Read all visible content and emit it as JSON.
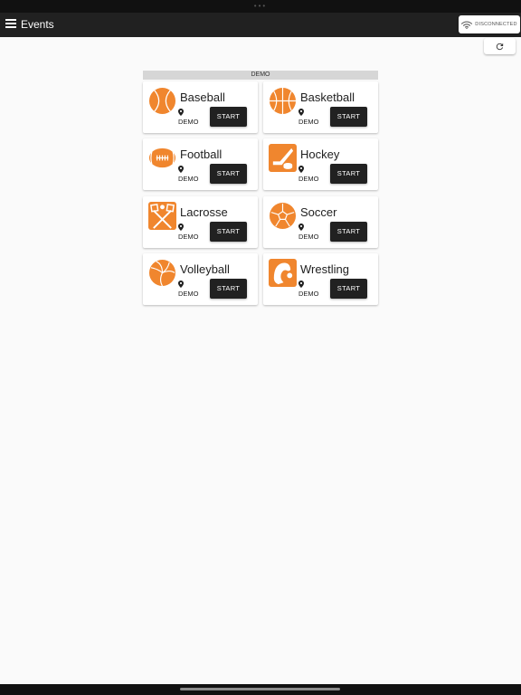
{
  "app": {
    "title": "Events"
  },
  "connection": {
    "status": "DISCONNECTED"
  },
  "group": {
    "label": "DEMO"
  },
  "accent_color": "#f0862e",
  "events": [
    {
      "name": "Baseball",
      "icon": "baseball-icon",
      "location": "DEMO",
      "action": "START"
    },
    {
      "name": "Basketball",
      "icon": "basketball-icon",
      "location": "DEMO",
      "action": "START"
    },
    {
      "name": "Football",
      "icon": "football-icon",
      "location": "DEMO",
      "action": "START"
    },
    {
      "name": "Hockey",
      "icon": "hockey-icon",
      "location": "DEMO",
      "action": "START"
    },
    {
      "name": "Lacrosse",
      "icon": "lacrosse-icon",
      "location": "DEMO",
      "action": "START"
    },
    {
      "name": "Soccer",
      "icon": "soccer-icon",
      "location": "DEMO",
      "action": "START"
    },
    {
      "name": "Volleyball",
      "icon": "volleyball-icon",
      "location": "DEMO",
      "action": "START"
    },
    {
      "name": "Wrestling",
      "icon": "wrestling-icon",
      "location": "DEMO",
      "action": "START"
    }
  ]
}
